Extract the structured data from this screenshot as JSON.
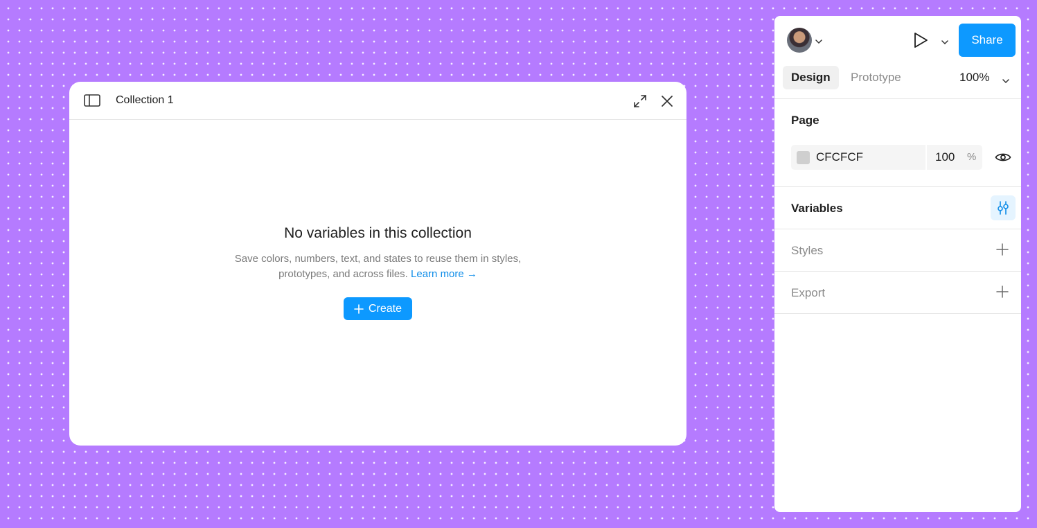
{
  "modal": {
    "title": "Collection 1",
    "empty_title": "No variables in this collection",
    "empty_desc": "Save colors, numbers, text, and states to reuse them in styles, prototypes, and across files.",
    "learn_more": "Learn more →",
    "create_label": "Create"
  },
  "header": {
    "share_label": "Share"
  },
  "tabs": [
    {
      "label": "Design",
      "active": true
    },
    {
      "label": "Prototype",
      "active": false
    }
  ],
  "zoom": "100%",
  "page_section": {
    "title": "Page",
    "color_hex": "CFCFCF",
    "opacity": "100",
    "opacity_unit": "%"
  },
  "sections": {
    "variables": "Variables",
    "styles": "Styles",
    "export": "Export"
  },
  "colors": {
    "canvas": "#b57bff",
    "accent": "#0d99ff",
    "swatch": "#cfcfcf"
  }
}
